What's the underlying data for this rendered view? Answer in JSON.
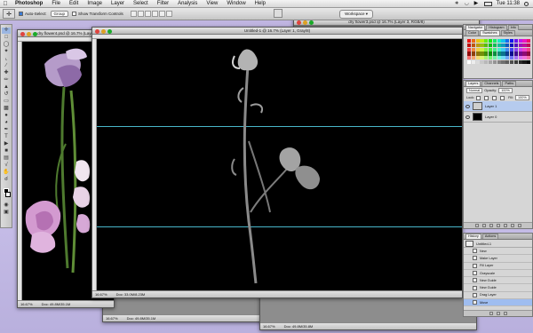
{
  "menubar": {
    "app_name": "Photoshop",
    "items": [
      "File",
      "Edit",
      "Image",
      "Layer",
      "Select",
      "Filter",
      "Analysis",
      "View",
      "Window",
      "Help"
    ],
    "clock": "Tue 11:38"
  },
  "options": {
    "auto_select_label": "Auto-Select:",
    "auto_select_value": "Group",
    "show_transform_label": "Show Transform Controls",
    "workspace_label": "Workspace ▾"
  },
  "windows": {
    "flower4": {
      "title": "dry flower4.psd @ 16.7% (Layer 4, RGB/8)",
      "zoom": "16.67%",
      "doc_info": "Doc: 49.8M/35.1M"
    },
    "untitled": {
      "title": "Untitled-1 @ 16.7% (Layer 1, Gray/8)",
      "zoom": "16.67%",
      "doc_info": "Doc: 33.0M/8.23M"
    },
    "flower3": {
      "title": "dry flower3.psd @ 16.7% (Layer 3, RGB/8)",
      "zoom": "16.67%",
      "doc_info": "Doc: 49.8M/35.1M"
    },
    "back1": {
      "zoom": "16.67%",
      "doc_info": "Doc: 49.8M/35.1M"
    },
    "back2": {
      "zoom": "16.67%",
      "doc_info": "Doc: 49.8M/35.8M"
    }
  },
  "panels": {
    "color": {
      "tabs": [
        "Color",
        "Swatches",
        "Styles"
      ],
      "top_tabs": [
        "Navigator",
        "Histogram",
        "Info"
      ]
    },
    "layers": {
      "tabs": [
        "Layers",
        "Channels",
        "Paths"
      ],
      "blend_mode": "Normal",
      "opacity_label": "Opacity:",
      "opacity_value": "100%",
      "lock_label": "Lock:",
      "fill_label": "Fill:",
      "fill_value": "100%",
      "items": [
        {
          "name": "Layer 1",
          "selected": true
        },
        {
          "name": "Layer 0",
          "selected": false
        }
      ]
    },
    "history": {
      "tabs": [
        "History",
        "Actions"
      ],
      "snapshot": "Untitled-1",
      "items": [
        "New",
        "Make Layer",
        "Fill Layer",
        "Grayscale",
        "New Guide",
        "New Guide",
        "Drag Layer",
        "Move"
      ]
    }
  },
  "colors": {
    "desktop": "#c3b9e6",
    "guide": "#49b6c9",
    "selection": "#b6cbee"
  }
}
